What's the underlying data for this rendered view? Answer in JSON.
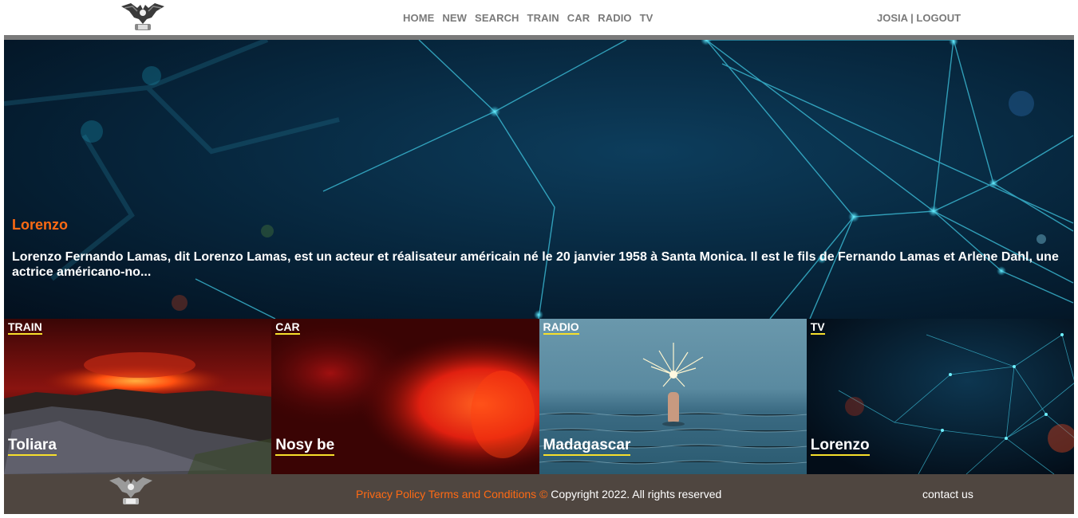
{
  "header": {
    "logo_icon": "eagle-logo-icon",
    "nav": [
      {
        "label": "HOME"
      },
      {
        "label": "NEW"
      },
      {
        "label": "SEARCH"
      },
      {
        "label": "TRAIN"
      },
      {
        "label": "CAR"
      },
      {
        "label": "RADIO"
      },
      {
        "label": "TV"
      }
    ],
    "user_name": "JOSIA",
    "separator": "|",
    "logout_label": "LOGOUT"
  },
  "hero": {
    "title": "Lorenzo",
    "description": "Lorenzo Fernando Lamas, dit Lorenzo Lamas, est un acteur et réalisateur américain né le 20 janvier 1958 à Santa Monica. Il est le fils de Fernando Lamas et Arlene Dahl, une actrice américano-no...",
    "accent_color": "#ff6a13"
  },
  "cards": [
    {
      "category": "TRAIN",
      "name": "Toliara"
    },
    {
      "category": "CAR",
      "name": "Nosy be"
    },
    {
      "category": "RADIO",
      "name": "Madagascar"
    },
    {
      "category": "TV",
      "name": "Lorenzo"
    }
  ],
  "footer": {
    "privacy_label": "Privacy Policy",
    "terms_label": "Terms and Conditions",
    "copyright_symbol": "©",
    "copyright_text": "Copyright 2022. All rights reserved",
    "contact_label": "contact us",
    "background_color": "#4f4640"
  },
  "colors": {
    "nav_text": "#7a7a7a",
    "underline": "#f7e02b"
  }
}
